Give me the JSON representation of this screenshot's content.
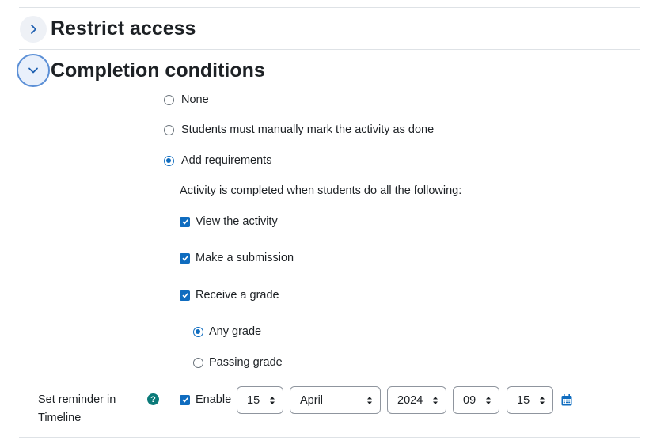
{
  "sections": {
    "restrict": {
      "title": "Restrict access"
    },
    "completion": {
      "title": "Completion conditions"
    }
  },
  "completion": {
    "options": {
      "none": "None",
      "manual": "Students must manually mark the activity as done",
      "add": "Add requirements"
    },
    "selected": "add",
    "intro": "Activity is completed when students do all the following:",
    "requirements": {
      "view": "View the activity",
      "submit": "Make a submission",
      "grade": "Receive a grade"
    },
    "grade_options": {
      "any": "Any grade",
      "passing": "Passing grade"
    },
    "grade_selected": "any"
  },
  "reminder": {
    "label": "Set reminder in Timeline",
    "help": "?",
    "enable": "Enable",
    "enabled": true,
    "day": "15",
    "month": "April",
    "year": "2024",
    "hour": "09",
    "minute": "15"
  },
  "colors": {
    "accent": "#0f6cbf",
    "help": "#0b7a79",
    "border": "#8f959e"
  },
  "icons": {
    "collapsed": "chevron-right-icon",
    "expanded": "chevron-down-icon",
    "calendar": "calendar-icon",
    "help": "help-icon"
  }
}
